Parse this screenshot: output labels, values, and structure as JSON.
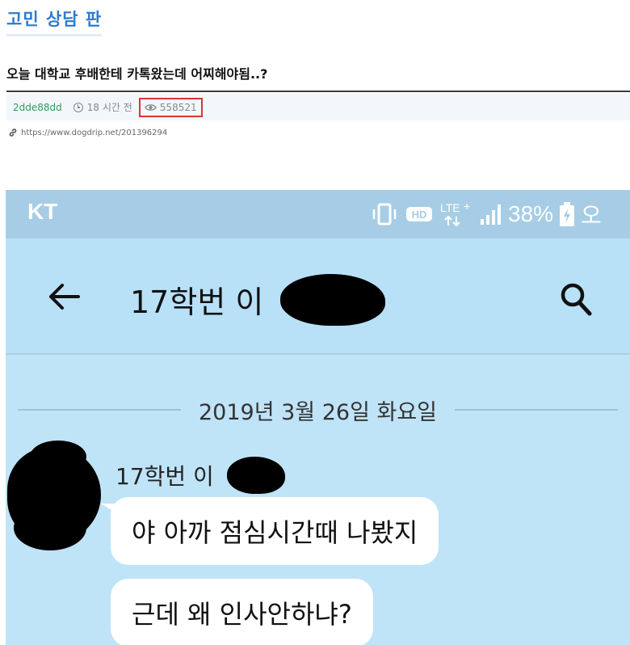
{
  "board": {
    "title": "고민 상담 판"
  },
  "post": {
    "title": "오늘 대학교 후배한테 카톡왔는데 어찌해야됨..?",
    "author": "2dde88dd",
    "time_ago": "18 시간 전",
    "views": "558521",
    "url": "https://www.dogdrip.net/201396294"
  },
  "phone": {
    "status_bar": {
      "carrier": "KT",
      "network": "LTE+",
      "hd_label": "HD",
      "battery": "38%",
      "clock_partial": "오"
    },
    "chat": {
      "name": "17학번 이",
      "date": "2019년 3월 26일 화요일",
      "sender": "17학번 이",
      "messages": [
        "야 아까 점심시간때 나봤지",
        "근데 왜 인사안하냐?"
      ]
    },
    "colors": {
      "status_bar": "#a6cde5",
      "chat_background": "#bfe3f7",
      "bubble": "#ffffff"
    }
  },
  "icons": [
    "clock-icon",
    "eye-icon",
    "link-icon",
    "vibrate-icon",
    "hd-icon",
    "lte-icon",
    "signal-icon",
    "battery-icon",
    "back-arrow-icon",
    "search-icon"
  ]
}
